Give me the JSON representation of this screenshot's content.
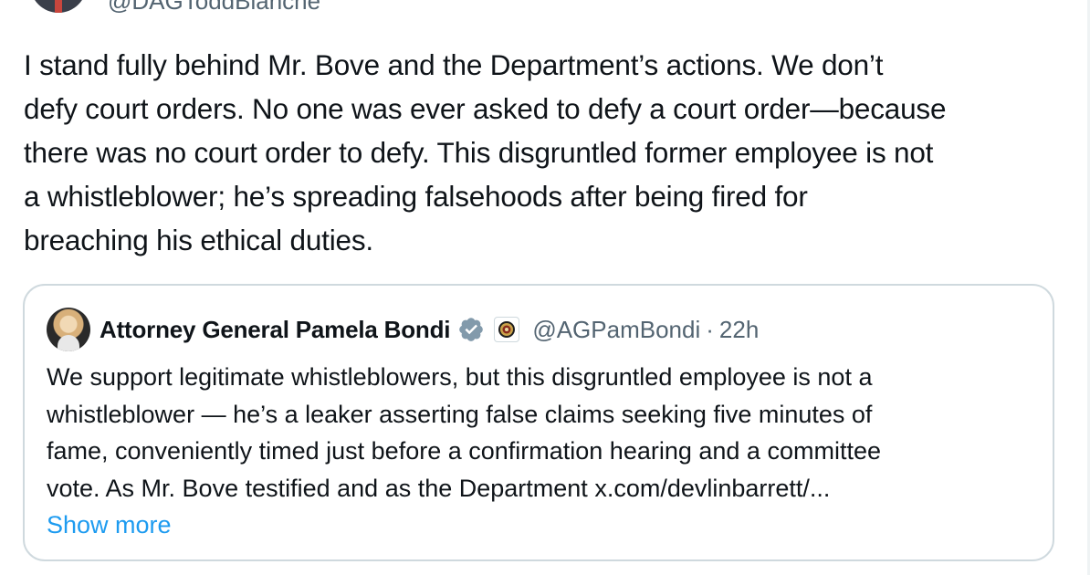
{
  "author": {
    "handle": "@DAGToddBlanche"
  },
  "tweet": {
    "text": "I stand fully behind Mr. Bove and the Department’s actions. We don’t\ndefy court orders. No one was ever asked to defy a court order—because\nthere was no court order to defy. This disgruntled former employee is not\na whistleblower; he’s spreading falsehoods after being fired for\nbreaching his ethical duties."
  },
  "quote": {
    "name": "Attorney General Pamela Bondi",
    "handle": "@AGPamBondi",
    "separator": "·",
    "time": "22h",
    "text": "We support legitimate whistleblowers, but this disgruntled employee is not a\nwhistleblower — he’s a leaker asserting false claims seeking five minutes of\nfame, conveniently timed just before a confirmation hearing and a committee\nvote. As Mr. Bove testified and as the Department x.com/devlinbarrett/...",
    "show_more": "Show more",
    "verified_badge_icon": "verified-badge-icon",
    "government_seal_icon": "doj-seal-icon"
  },
  "colors": {
    "text": "#0f1419",
    "secondary": "#536471",
    "link": "#1d9bf0",
    "border": "#cfd9de",
    "verified_grey": "#829aab"
  }
}
